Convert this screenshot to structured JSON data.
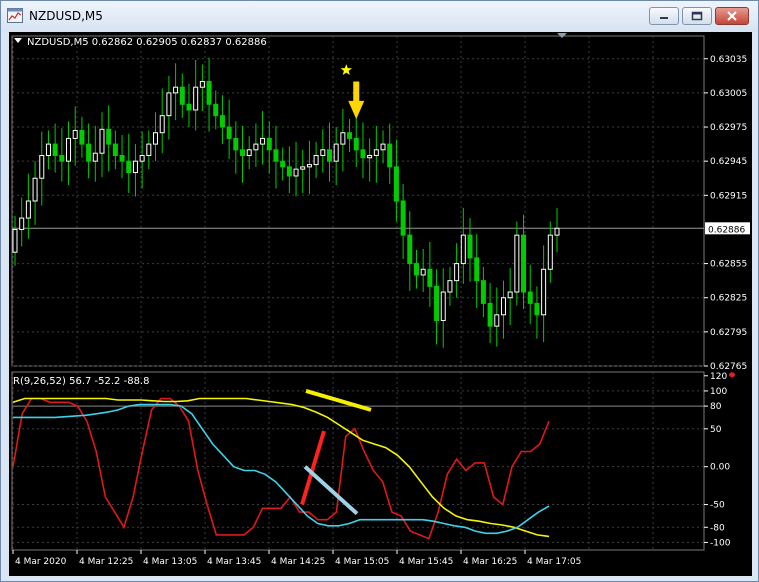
{
  "window": {
    "title": "NZDUSD,M5"
  },
  "header": {
    "label": "NZDUSD,M5  0.62862 0.62905 0.62837 0.62886"
  },
  "indicator": {
    "label": "R(9,26,52) 56.7 -52.2 -88.8"
  },
  "colors": {
    "background": "#000000",
    "grid": "#3d3d3d",
    "bull": "#ffffff",
    "bear": "#00cc00",
    "series_red": "#e01818",
    "series_yellow": "#f5f500",
    "series_cyan": "#3cd2ea",
    "annotation_yellow": "#f5f000",
    "annotation_red": "#ff2020",
    "annotation_lightblue": "#9ed2e6",
    "arrow": "#ffd700",
    "star": "#ffff00"
  },
  "icons": {
    "arrow": "down-arrow-icon",
    "star": "star-icon"
  },
  "chart_data": [
    {
      "type": "candlestick",
      "title": "NZDUSD,M5",
      "ohlc": {
        "open": 0.62862,
        "high": 0.62905,
        "low": 0.62837,
        "close": 0.62886
      },
      "current_price_label": "0.62886",
      "y_ticks": [
        "0.63035",
        "0.63005",
        "0.62975",
        "0.62945",
        "0.62915",
        "0.62886",
        "0.62855",
        "0.62825",
        "0.62795",
        "0.62765"
      ],
      "ylim": [
        0.62765,
        0.63055
      ],
      "closes": [
        0.62885,
        0.62895,
        0.6291,
        0.6293,
        0.6295,
        0.6296,
        0.6295,
        0.62945,
        0.62965,
        0.62972,
        0.6296,
        0.62945,
        0.62952,
        0.62973,
        0.6296,
        0.6295,
        0.62945,
        0.62935,
        0.62945,
        0.6295,
        0.6296,
        0.6297,
        0.62985,
        0.63005,
        0.6301,
        0.62995,
        0.6299,
        0.6301,
        0.63015,
        0.62995,
        0.62985,
        0.62975,
        0.62965,
        0.62955,
        0.6295,
        0.62955,
        0.6296,
        0.62965,
        0.62955,
        0.62945,
        0.6294,
        0.62932,
        0.62938,
        0.6294,
        0.62942,
        0.6295,
        0.62955,
        0.62945,
        0.6296,
        0.6297,
        0.62965,
        0.62955,
        0.62948,
        0.6295,
        0.62955,
        0.6296,
        0.6294,
        0.6291,
        0.6288,
        0.62855,
        0.62845,
        0.6285,
        0.62835,
        0.62805,
        0.6283,
        0.6284,
        0.62855,
        0.6288,
        0.6286,
        0.6284,
        0.6282,
        0.628,
        0.6281,
        0.62825,
        0.6283,
        0.6288,
        0.6283,
        0.6282,
        0.6281,
        0.6285,
        0.6288,
        0.62886
      ],
      "highs_extremes": {
        "max": 0.6305,
        "min_low": 0.6278
      }
    },
    {
      "type": "line",
      "title": "R(9,26,52)",
      "values_shown": [
        56.7,
        -52.2,
        -88.8
      ],
      "y_ticks": [
        "120",
        "100",
        "80",
        "50",
        "0.00",
        "-50",
        "-80",
        "-100"
      ],
      "ylim": [
        -110,
        125
      ],
      "reference_line": 80,
      "series": [
        {
          "name": "R(9)",
          "color": "red",
          "values": [
            0,
            70,
            90,
            90,
            85,
            85,
            85,
            80,
            60,
            20,
            -40,
            -60,
            -80,
            -40,
            20,
            75,
            90,
            90,
            80,
            60,
            -5,
            -50,
            -90,
            -90,
            -90,
            -90,
            -80,
            -55,
            -55,
            -55,
            -40,
            -60,
            -60,
            -70,
            -70,
            -60,
            40,
            50,
            20,
            -5,
            -20,
            -60,
            -65,
            -85,
            -90,
            -95,
            -60,
            -10,
            10,
            -5,
            5,
            5,
            -40,
            -50,
            0,
            20,
            20,
            30,
            60
          ]
        },
        {
          "name": "R(26)",
          "color": "yellow",
          "values": [
            85,
            90,
            90,
            90,
            90,
            90,
            90,
            90,
            90,
            88,
            88,
            88,
            87,
            86,
            86,
            87,
            90,
            90,
            90,
            90,
            90,
            88,
            86,
            84,
            82,
            78,
            72,
            65,
            55,
            45,
            35,
            30,
            25,
            15,
            0,
            -20,
            -40,
            -55,
            -65,
            -70,
            -72,
            -75,
            -77,
            -80,
            -85,
            -90,
            -92
          ]
        },
        {
          "name": "R(52)",
          "color": "cyan",
          "values": [
            65,
            65,
            65,
            65,
            65,
            66,
            67,
            68,
            70,
            72,
            75,
            80,
            82,
            82,
            82,
            82,
            80,
            70,
            50,
            30,
            15,
            0,
            -5,
            -5,
            -10,
            -20,
            -35,
            -50,
            -65,
            -75,
            -78,
            -78,
            -75,
            -70,
            -70,
            -70,
            -70,
            -70,
            -70,
            -70,
            -72,
            -75,
            -78,
            -80,
            -85,
            -88,
            -88,
            -85,
            -80,
            -70,
            -60,
            -52
          ]
        }
      ]
    }
  ],
  "x_axis": {
    "labels": [
      "4 Mar 2020",
      "4 Mar 12:25",
      "4 Mar 13:05",
      "4 Mar 13:45",
      "4 Mar 14:25",
      "4 Mar 15:05",
      "4 Mar 15:45",
      "4 Mar 16:25",
      "4 Mar 17:05"
    ]
  }
}
